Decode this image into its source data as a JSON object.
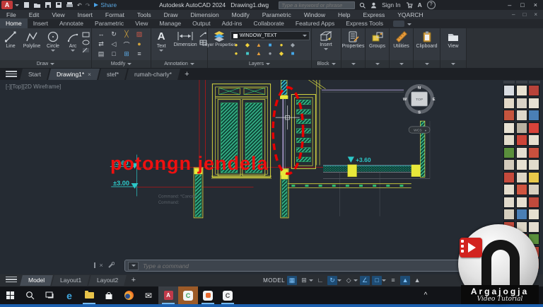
{
  "title_bar": {
    "app_button": "A",
    "share": "Share",
    "app_title": "Autodesk AutoCAD 2024",
    "doc_title": "Drawing1.dwg",
    "search_placeholder": "Type a keyword or phrase",
    "sign_in": "Sign In",
    "access_label": "A",
    "help_label": "?",
    "undo_glyph": "↶",
    "redo_glyph": "↷",
    "min": "–",
    "max": "□",
    "close": "×"
  },
  "menu_bar": {
    "items": [
      "File",
      "Edit",
      "View",
      "Insert",
      "Format",
      "Tools",
      "Draw",
      "Dimension",
      "Modify",
      "Parametric",
      "Window",
      "Help",
      "Express",
      "YQARCH"
    ],
    "min": "–",
    "max": "□",
    "close": "×"
  },
  "ribbon": {
    "tabs": [
      "Home",
      "Insert",
      "Annotate",
      "Parametric",
      "View",
      "Manage",
      "Output",
      "Add-ins",
      "Collaborate",
      "Featured Apps",
      "Express Tools"
    ],
    "draw": {
      "label": "Draw",
      "b0": "Line",
      "b1": "Polyline",
      "b2": "Circle",
      "b3": "Arc"
    },
    "modify": {
      "label": "Modify",
      "glyphs": [
        "↔",
        "↻",
        "╳",
        "▨",
        "⇄",
        "◁",
        "⌒",
        "●",
        "▤",
        "□",
        "⊞",
        "≡"
      ]
    },
    "annotation": {
      "label": "Annotation",
      "a_glyph": "A",
      "text": "Text",
      "dimension": "Dimension"
    },
    "layers": {
      "label": "Layers",
      "layer_properties": "Layer Properties",
      "current_layer": "WINDOW_TEXT",
      "state_glyphs": [
        "●",
        "◆",
        "▲",
        "■",
        "●",
        "◆",
        "●",
        "■",
        "▲",
        "●",
        "◆",
        "■"
      ]
    },
    "block": {
      "label": "Block",
      "insert": "Insert"
    },
    "panels": [
      "Properties",
      "Groups",
      "Utilities",
      "Clipboard",
      "View"
    ]
  },
  "file_tabs": {
    "items": [
      "Start",
      "Drawing1*",
      "stef*",
      "rumah-charly*"
    ],
    "close_glyph": "×",
    "new_tab": "+"
  },
  "viewport": {
    "corner_label": "[-][Top][2D Wireframe]",
    "annotation": "potongn jendela",
    "elev_upper": "±3.60",
    "elev_lower": "±3.00",
    "elev_right": "+3.60",
    "viewcube": {
      "n": "N",
      "e": "E",
      "s": "S",
      "w": "W",
      "face": "TOP",
      "wcs": "WCS"
    },
    "history": [
      "Command: *Cancel*",
      "Command:"
    ]
  },
  "command_line": {
    "placeholder": "Type a command",
    "close_glyph": "×"
  },
  "status_bar": {
    "tabs": [
      "Model",
      "Layout1",
      "Layout2"
    ],
    "new_tab": "+",
    "model_label": "MODEL",
    "icons": [
      "▦",
      "⊞",
      "∟",
      "↻",
      "◇",
      "∠",
      "□",
      "≡",
      "▲",
      "▲"
    ]
  },
  "taskbar": {
    "edge": "e",
    "mail_glyph": "✉",
    "autocad_glyph": "A",
    "camtasia_glyph": "C",
    "recorder_glyph": "C",
    "tray_caret": "^"
  },
  "logo": {
    "title": "Argajogja",
    "subtitle": "Video Tutorial"
  },
  "palette": {
    "tiles": [
      "#d9dde2",
      "#e9e2d2",
      "#b8433a",
      "#e2d9c8",
      "#d8d2c6",
      "#e6e0d2",
      "#c5553e",
      "#ded8ca",
      "#4a7fb5",
      "#e8e2d4",
      "#b8b0a0",
      "#d8433a",
      "#e2dccc",
      "#cc4438",
      "#e6dfd0",
      "#5a8f3c",
      "#e4ded0",
      "#c8503e",
      "#d2cabb",
      "#e6e0d2",
      "#e2dccc",
      "#c54a3c",
      "#ddd6c6",
      "#e8c84a",
      "#e4ddcd",
      "#cf5540",
      "#d8d0c0",
      "#e0dacc",
      "#e6dfd0",
      "#bf4a3c",
      "#d5cebe",
      "#4a7fb5",
      "#e6e0d0",
      "#c84e3e",
      "#dcd5c5",
      "#e4ddcf",
      "#e2dbcd",
      "#d05040",
      "#5a8f3c",
      "#ded7c9",
      "#e8c84a",
      "#c2483a",
      "#e6e0d2",
      "#dad3c5",
      "#cd5242"
    ]
  },
  "colors": {
    "cad_yellow": "#e8e83a",
    "cad_cyan": "#2cc8c8",
    "cad_red": "#e60000",
    "hatch_green": "#37b98d"
  }
}
